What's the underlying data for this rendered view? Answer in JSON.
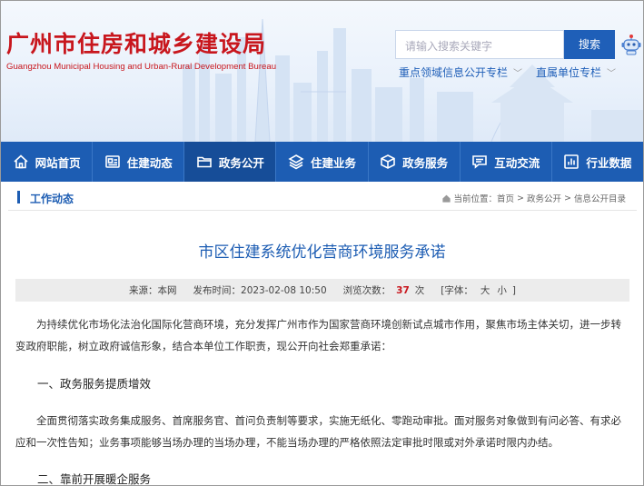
{
  "header": {
    "logo_cn": "广州市住房和城乡建设局",
    "logo_en": "Guangzhou Municipal Housing and Urban-Rural Development Bureau",
    "search_placeholder": "请输入搜索关键字",
    "search_button": "搜索",
    "link_key_areas": "重点领域信息公开专栏",
    "link_direct_units": "直属单位专栏"
  },
  "nav": {
    "items": [
      {
        "label": "网站首页",
        "icon": "home-icon"
      },
      {
        "label": "住建动态",
        "icon": "news-icon"
      },
      {
        "label": "政务公开",
        "icon": "folder-icon"
      },
      {
        "label": "住建业务",
        "icon": "layers-icon"
      },
      {
        "label": "政务服务",
        "icon": "box-icon"
      },
      {
        "label": "互动交流",
        "icon": "chat-icon"
      },
      {
        "label": "行业数据",
        "icon": "bar-chart-icon"
      }
    ],
    "active_index": 2
  },
  "breadcrumb": {
    "section_title": "工作动态",
    "prefix": "当前位置：",
    "items": [
      "首页",
      "政务公开",
      "信息公开目录"
    ]
  },
  "article": {
    "title": "市区住建系统优化营商环境服务承诺",
    "meta": {
      "source_label": "来源：",
      "source": "本网",
      "time_label": "发布时间：",
      "time": "2023-02-08 10:50",
      "views_label": "浏览次数：",
      "views": "37",
      "views_unit": "次",
      "font_label": "[字体：",
      "font_large": "大",
      "font_small": "小",
      "font_close": "]"
    },
    "intro": "为持续优化市场化法治化国际化营商环境，充分发挥广州市作为国家营商环境创新试点城市作用，聚焦市场主体关切，进一步转变政府职能，树立政府诚信形象，结合本单位工作职责，现公开向社会郑重承诺：",
    "heading1": "一、政务服务提质增效",
    "para1": "全面贯彻落实政务集成服务、首席服务官、首问负责制等要求，实施无纸化、零跑动审批。面对服务对象做到有问必答、有求必应和一次性告知；业务事项能够当场办理的当场办理，不能当场办理的严格依照法定审批时限或对外承诺时限内办结。",
    "heading2": "二、靠前开展暖企服务"
  },
  "colors": {
    "brand_red": "#c8161d",
    "nav_blue": "#1d5db3",
    "title_blue": "#1d5db3"
  }
}
